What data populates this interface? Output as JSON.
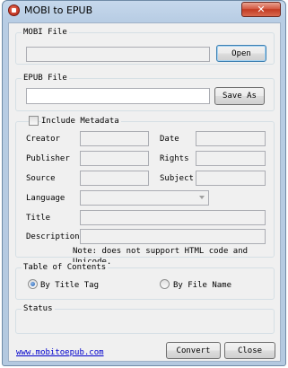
{
  "window": {
    "title": "MOBI to EPUB",
    "close_label": "✕"
  },
  "mobi_file": {
    "legend": "MOBI File",
    "path_value": "",
    "open_label": "Open"
  },
  "epub_file": {
    "legend": "EPUB File",
    "path_value": "",
    "save_as_label": "Save As"
  },
  "metadata": {
    "include_label": "Include Metadata",
    "include_checked": false,
    "creator_label": "Creator",
    "date_label": "Date",
    "publisher_label": "Publisher",
    "rights_label": "Rights",
    "source_label": "Source",
    "subject_label": "Subject",
    "language_label": "Language",
    "title_label": "Title",
    "description_label": "Description",
    "note": "Note: does not support HTML code and Unicode."
  },
  "toc": {
    "legend": "Table of Contents",
    "option_title_tag": "By Title Tag",
    "option_file_name": "By File Name",
    "selected": "By Title Tag"
  },
  "status": {
    "legend": "Status",
    "text": ""
  },
  "footer": {
    "link_text": "www.mobitoepub.com",
    "convert_label": "Convert",
    "close_label": "Close"
  },
  "colors": {
    "link": "#0000cc",
    "close_button": "#c23b22",
    "title_bar": "#c6d8ec"
  }
}
